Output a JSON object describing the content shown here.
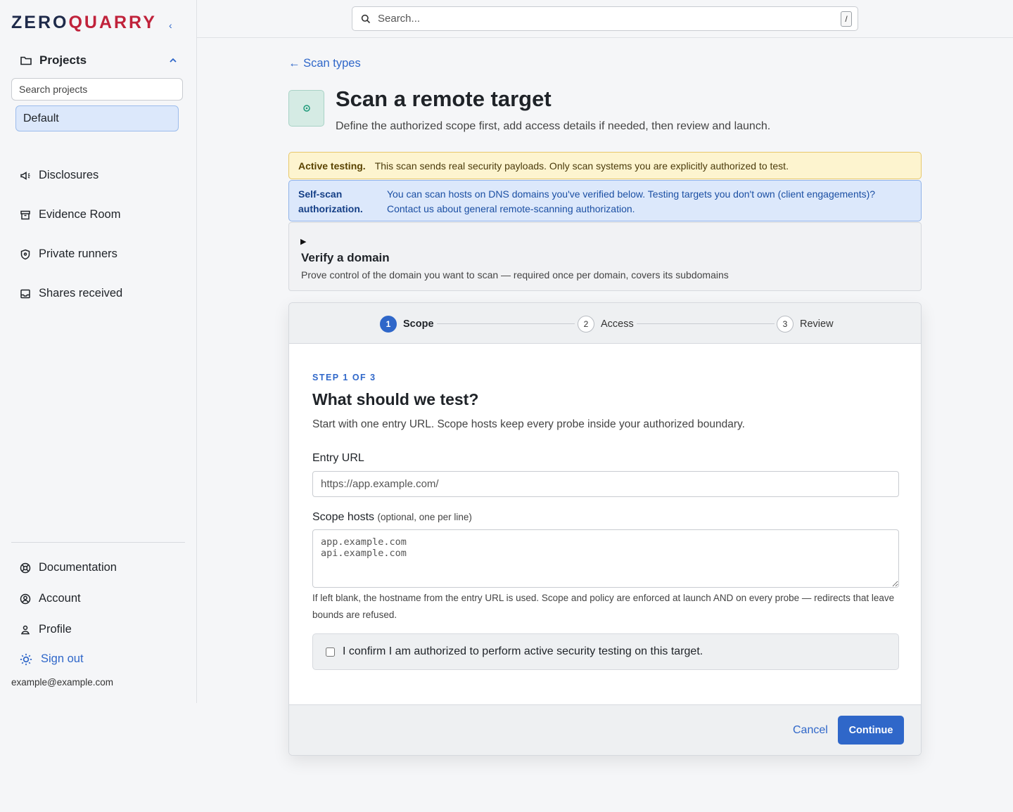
{
  "brand": {
    "part1": "ZERO",
    "part2": "QUARRY"
  },
  "sidebar": {
    "collapse_glyph": "‹",
    "projects_label": "Projects",
    "project_search_placeholder": "Search projects",
    "selected_project": "Default",
    "nav": [
      {
        "label": "Disclosures",
        "icon": "megaphone-icon"
      },
      {
        "label": "Evidence Room",
        "icon": "archive-icon"
      },
      {
        "label": "Private runners",
        "icon": "shield-icon"
      },
      {
        "label": "Shares received",
        "icon": "inbox-icon"
      }
    ],
    "footer_nav": [
      {
        "label": "Documentation",
        "icon": "lifebuoy-icon"
      },
      {
        "label": "Account",
        "icon": "user-circle-icon"
      },
      {
        "label": "Profile",
        "icon": "user-icon"
      }
    ],
    "signout_label": "Sign out",
    "user_email": "example@example.com"
  },
  "topbar": {
    "search_placeholder": "Search...",
    "shortcut_key": "/"
  },
  "main": {
    "back_link": "← Scan types",
    "title": "Scan a remote target",
    "subtitle": "Define the authorized scope first, add access details if needed, then review and launch.",
    "warning": {
      "label": "Active testing.",
      "text": "This scan sends real security payloads. Only scan systems you are explicitly authorized to test."
    },
    "info": {
      "label": "Self-scan authorization.",
      "text": "You can scan hosts on DNS domains you've verified below. Testing targets you don't own (client engagements)? Contact us about general remote-scanning authorization."
    },
    "verify": {
      "toggle": "▶",
      "title": "Verify a domain",
      "desc": "Prove control of the domain you want to scan — required once per domain, covers its subdomains"
    }
  },
  "wizard": {
    "steps": [
      {
        "num": "1",
        "label": "Scope"
      },
      {
        "num": "2",
        "label": "Access"
      },
      {
        "num": "3",
        "label": "Review"
      }
    ],
    "eyebrow": "STEP 1 OF 3",
    "title": "What should we test?",
    "desc": "Start with one entry URL. Scope hosts keep every probe inside your authorized boundary.",
    "entry_label": "Entry URL",
    "entry_placeholder": "https://app.example.com/",
    "scope_label": "Scope hosts",
    "scope_optional": "(optional, one per line)",
    "scope_placeholder": "app.example.com\napi.example.com",
    "hint": "If left blank, the hostname from the entry URL is used. Scope and policy are enforced at launch AND on every probe — redirects that leave bounds are refused.",
    "confirm_label": "I confirm I am authorized to perform active security testing on this target.",
    "cancel_label": "Cancel",
    "continue_label": "Continue"
  },
  "colors": {
    "accent": "#2f67c9",
    "brand_red": "#c0223b",
    "brand_navy": "#1e2a4a",
    "warn_bg": "#fdf4cf",
    "info_bg": "#dce8fb"
  }
}
